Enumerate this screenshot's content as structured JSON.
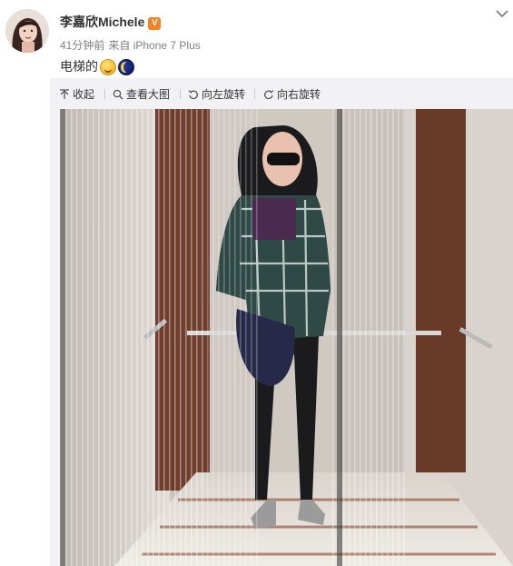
{
  "post": {
    "author": "李嘉欣Michele",
    "verified_mark": "V",
    "time": "41分钟前",
    "source": "来自 iPhone 7 Plus",
    "text": "电梯的",
    "emoji": [
      "grinning-face-emoji",
      "crescent-moon-emoji"
    ]
  },
  "toolbar": {
    "collapse_label": "收起",
    "view_large_label": "查看大图",
    "rotate_left_label": "向左旋转",
    "rotate_right_label": "向右旋转"
  },
  "icons": [
    "avatar",
    "verified-icon",
    "chevron-down-icon",
    "collapse-arrow-icon",
    "zoom-icon",
    "rotate-left-icon",
    "rotate-right-icon"
  ],
  "colors": {
    "verified_badge": "#f5821f",
    "name_text": "#333333",
    "meta_text": "#808080",
    "media_background": "#f2f2f5"
  }
}
